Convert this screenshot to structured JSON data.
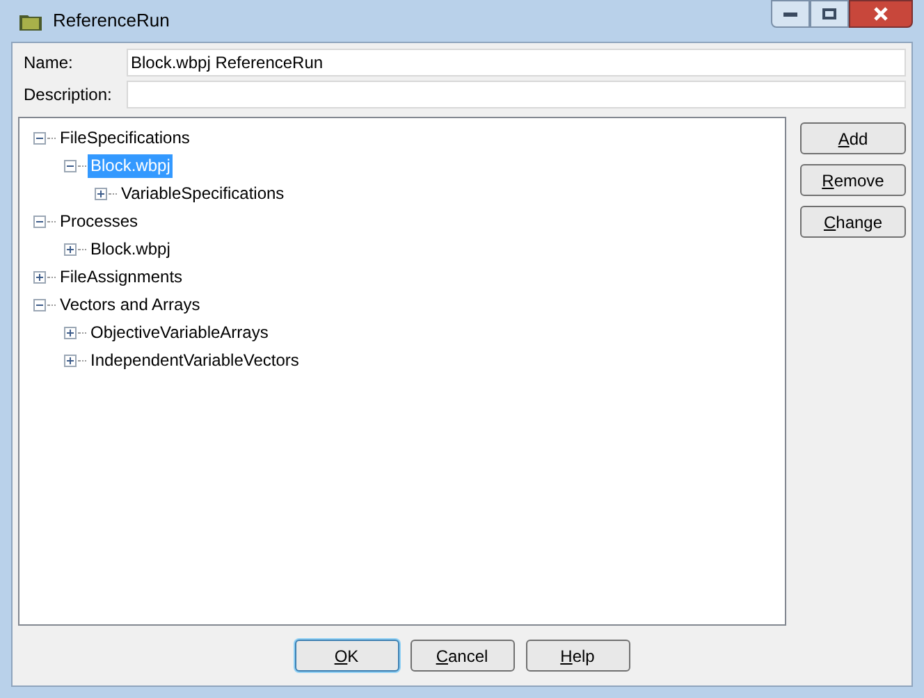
{
  "window": {
    "title": "ReferenceRun"
  },
  "name_field": {
    "label": "Name:",
    "value": "Block.wbpj ReferenceRun"
  },
  "description_field": {
    "label": "Description:"
  },
  "tree": [
    {
      "label": "FileSpecifications",
      "expanded": true,
      "selected": false,
      "children": [
        {
          "label": "Block.wbpj",
          "expanded": true,
          "selected": true,
          "children": [
            {
              "label": "VariableSpecifications",
              "expanded": false,
              "selected": false
            }
          ]
        }
      ]
    },
    {
      "label": "Processes",
      "expanded": true,
      "selected": false,
      "children": [
        {
          "label": "Block.wbpj",
          "expanded": false,
          "selected": false
        }
      ]
    },
    {
      "label": "FileAssignments",
      "expanded": false,
      "selected": false
    },
    {
      "label": "Vectors and Arrays",
      "expanded": true,
      "selected": false,
      "children": [
        {
          "label": "ObjectiveVariableArrays",
          "expanded": false,
          "selected": false
        },
        {
          "label": "IndependentVariableVectors",
          "expanded": false,
          "selected": false
        }
      ]
    }
  ],
  "side_buttons": [
    "Add",
    "Remove",
    "Change"
  ],
  "dialog_buttons": [
    {
      "label": "OK",
      "default": true
    },
    {
      "label": "Cancel",
      "default": false
    },
    {
      "label": "Help",
      "default": false
    }
  ]
}
